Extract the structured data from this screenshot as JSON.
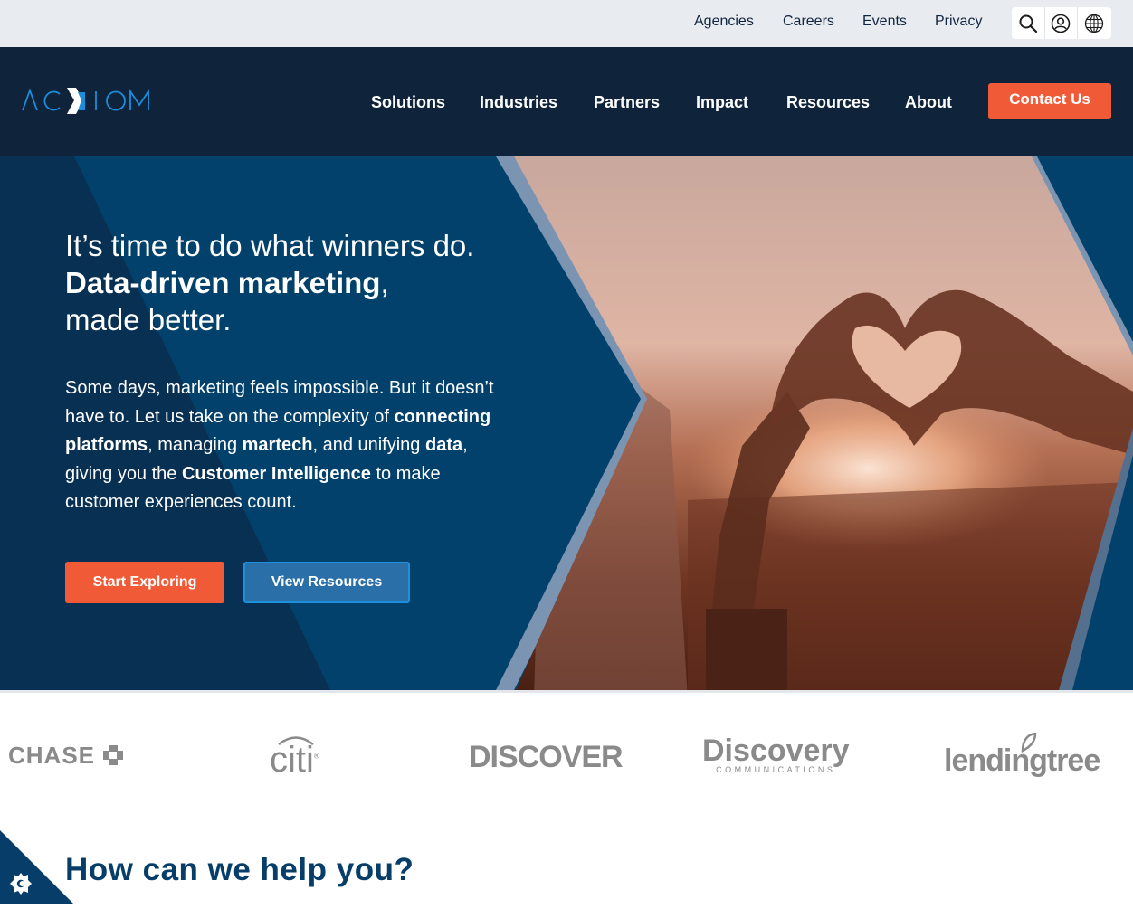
{
  "utility_nav": {
    "links": [
      "Agencies",
      "Careers",
      "Events",
      "Privacy"
    ],
    "icons": [
      "search-icon",
      "account-icon",
      "globe-icon"
    ]
  },
  "brand": {
    "logo_text": "ACXIOM",
    "colors": {
      "navy": "#0f243b",
      "hero_blue": "#02416b",
      "orange": "#f15a36",
      "logo_blue": "#1b8ddb",
      "secondary_blue": "#2a6fa8"
    }
  },
  "main_nav": {
    "items": [
      "Solutions",
      "Industries",
      "Partners",
      "Impact",
      "Resources",
      "About"
    ],
    "cta_label": "Contact Us"
  },
  "hero": {
    "headline_line1": "It’s time to do what winners do.",
    "headline_bold": "Data-driven marketing",
    "headline_comma": ",",
    "headline_line3": "made better.",
    "body": {
      "t1": "Some days, marketing feels impossible. But it doesn’t have to. Let us take on the complexity of ",
      "b1": "connecting platforms",
      "t2": ", managing ",
      "b2": "martech",
      "t3": ", and unifying ",
      "b3": "data",
      "t4": ", giving you the ",
      "b4": "Customer Intelligence",
      "t5": " to make customer experiences count."
    },
    "primary_button": "Start Exploring",
    "secondary_button": "View Resources",
    "image_description": "hands forming heart shape against sunset"
  },
  "client_logos": [
    {
      "name": "CHASE"
    },
    {
      "name": "citi"
    },
    {
      "name": "DISCOVER"
    },
    {
      "name": "Discovery",
      "sub": "COMMUNICATIONS"
    },
    {
      "name": "lendingtree"
    }
  ],
  "section": {
    "title": "How can we help you?"
  },
  "cookie_settings": {
    "icon": "cookie-settings-icon"
  }
}
